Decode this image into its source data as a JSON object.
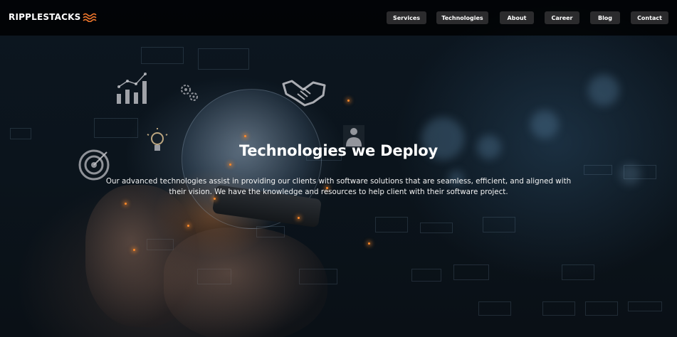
{
  "brand": {
    "name": "RIPPLESTACKS",
    "logo_icon": "wave-icon",
    "accent_color": "#f0772b"
  },
  "nav": {
    "items": [
      {
        "label": "Services"
      },
      {
        "label": "Technologies"
      },
      {
        "label": "About"
      },
      {
        "label": "Career"
      },
      {
        "label": "Blog"
      },
      {
        "label": "Contact"
      }
    ],
    "button_color": "#2b2b2d"
  },
  "hero": {
    "title": "Technologies we Deploy",
    "description": "Our advanced technologies assist in providing our clients with software solutions that are seamless, efficient, and aligned with their vision. We have the knowledge and resources to help client with their software project.",
    "background_icons": [
      "bar-chart-icon",
      "gears-icon",
      "handshake-icon",
      "lightbulb-icon",
      "person-icon",
      "target-icon",
      "globe-icon"
    ]
  }
}
